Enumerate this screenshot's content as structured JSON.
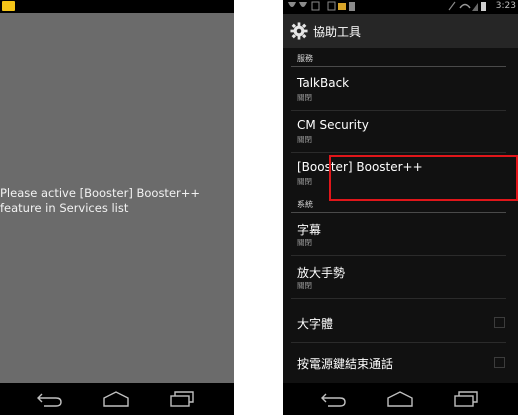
{
  "left_screen": {
    "message_line1": "Please active [Booster] Booster++",
    "message_line2": "feature in Services list",
    "status_icon_color": "#f5c518",
    "background_color": "#6b6b6b"
  },
  "right_screen": {
    "status_time": "3:23",
    "actionbar_title": "協助工具",
    "actionbar_icon": "gear-icon",
    "section_services": "服務",
    "section_system": "系統",
    "services_items": [
      {
        "title": "TalkBack",
        "status": "關閉"
      },
      {
        "title": "CM Security",
        "status": "關閉"
      },
      {
        "title": "[Booster] Booster++",
        "status": "關閉"
      }
    ],
    "system_items": [
      {
        "title": "字幕",
        "status": "關閉"
      },
      {
        "title": "放大手勢",
        "status": "關閉"
      }
    ],
    "checkbox_items": [
      {
        "title": "大字體",
        "checked": false
      },
      {
        "title": "按電源鍵結束通話",
        "checked": false
      }
    ],
    "highlight_color": "#e0161a"
  },
  "nav_icons": [
    "back-icon",
    "home-icon",
    "recent-apps-icon"
  ]
}
